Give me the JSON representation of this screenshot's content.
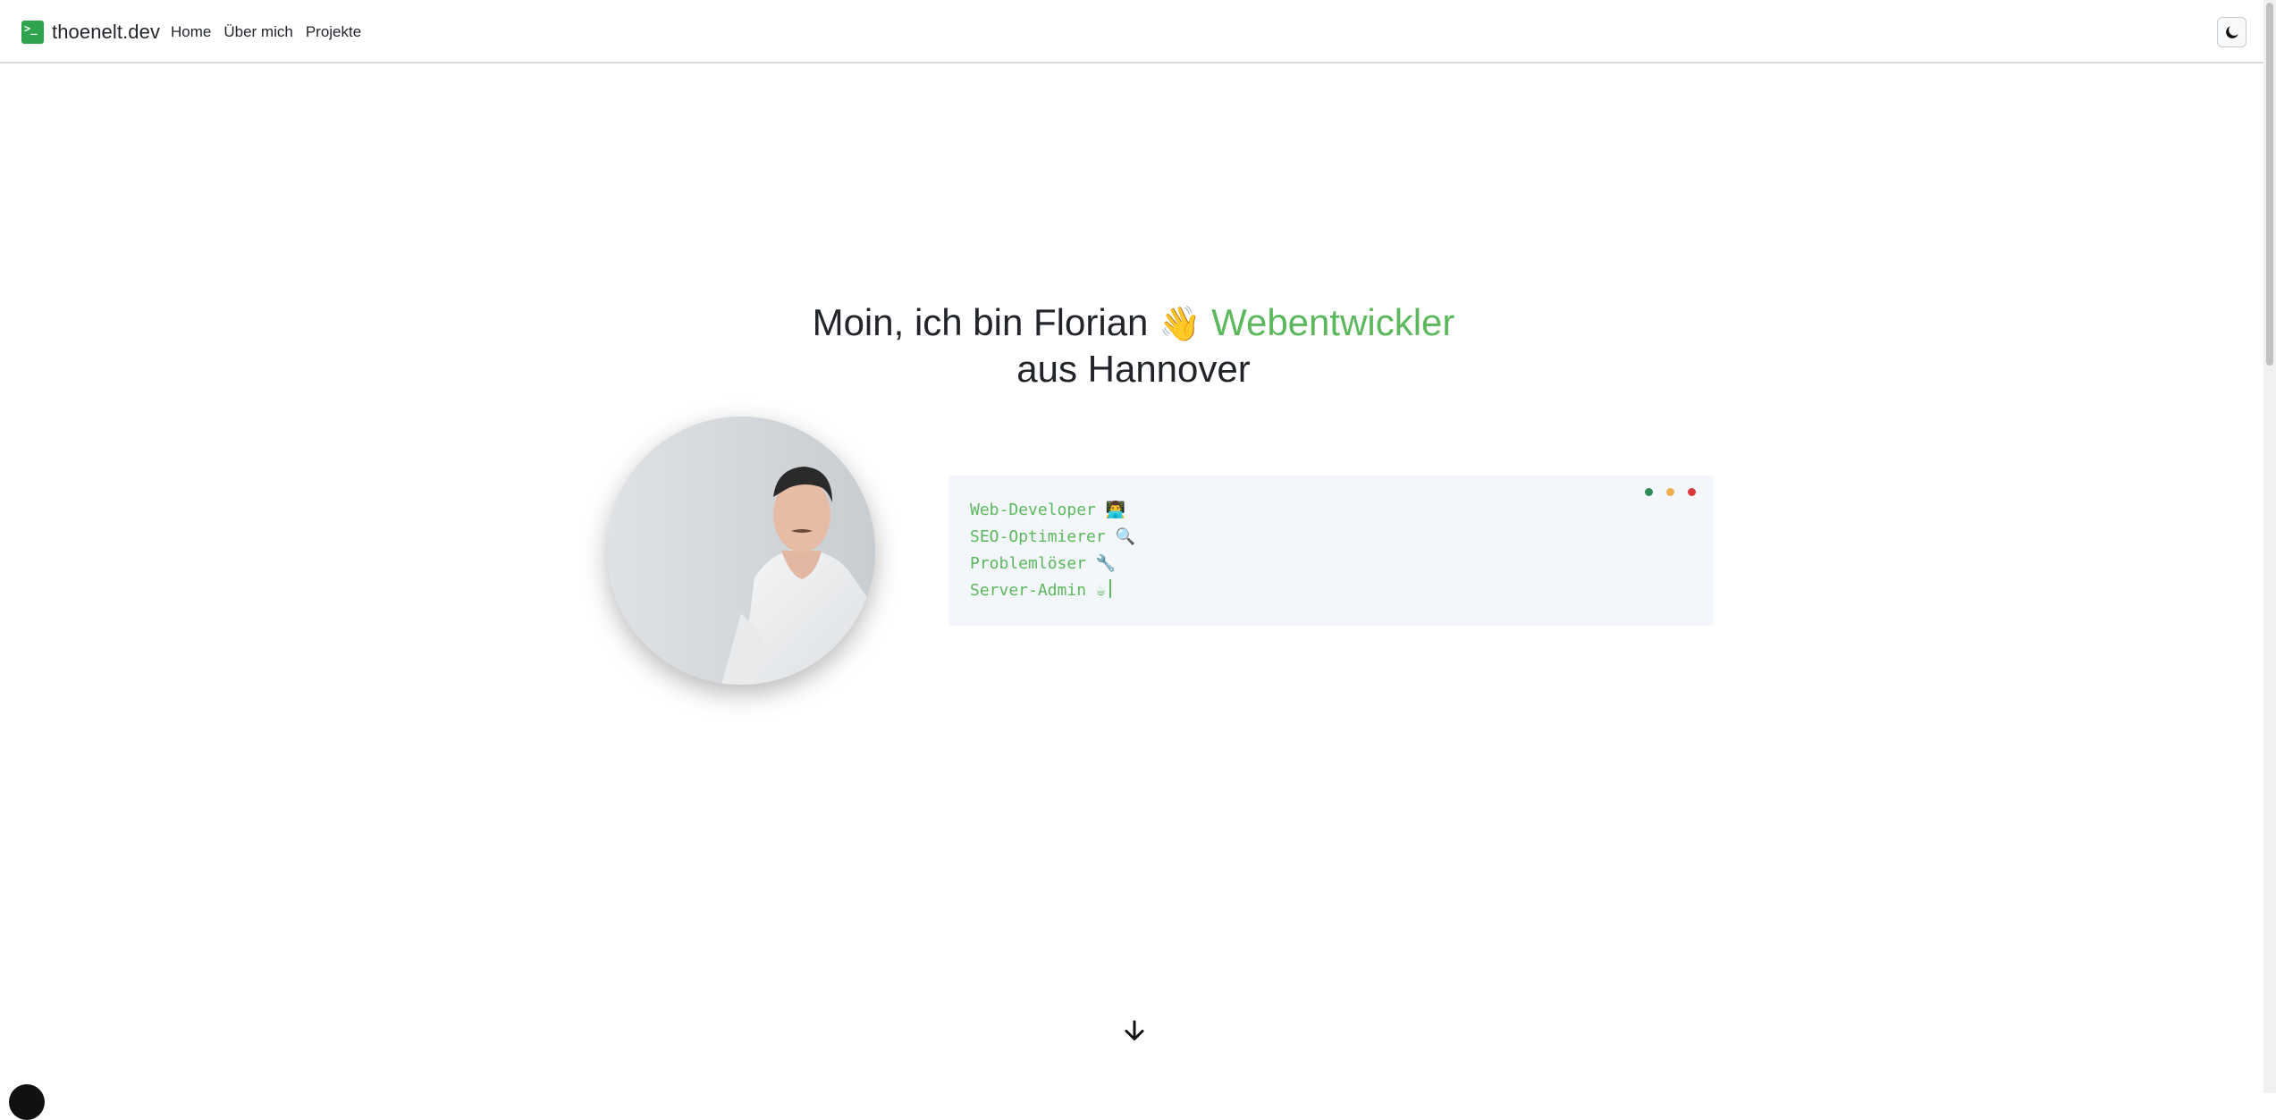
{
  "navbar": {
    "brand_logo_glyph": ">_",
    "brand_name": "thoenelt.dev",
    "links": [
      {
        "label": "Home"
      },
      {
        "label": "Über mich"
      },
      {
        "label": "Projekte"
      }
    ],
    "theme_toggle_icon": "moon-icon"
  },
  "hero": {
    "title_line1_prefix": "Moin, ich bin Florian",
    "wave_emoji": "👋",
    "title_accent": "Webentwickler",
    "title_line2": "aus Hannover",
    "accent_color": "#5cb85c"
  },
  "terminal": {
    "dots": [
      "#2e8b57",
      "#f0ad4e",
      "#d9363e"
    ],
    "lines": [
      {
        "text": "Web-Developer 👨‍💻"
      },
      {
        "text": "SEO-Optimierer 🔍"
      },
      {
        "text": "Problemlöser 🔧"
      },
      {
        "text": "Server-Admin ☕"
      }
    ]
  },
  "scroll_indicator_icon": "arrow-down-icon",
  "brand_color": "#2ea44f"
}
